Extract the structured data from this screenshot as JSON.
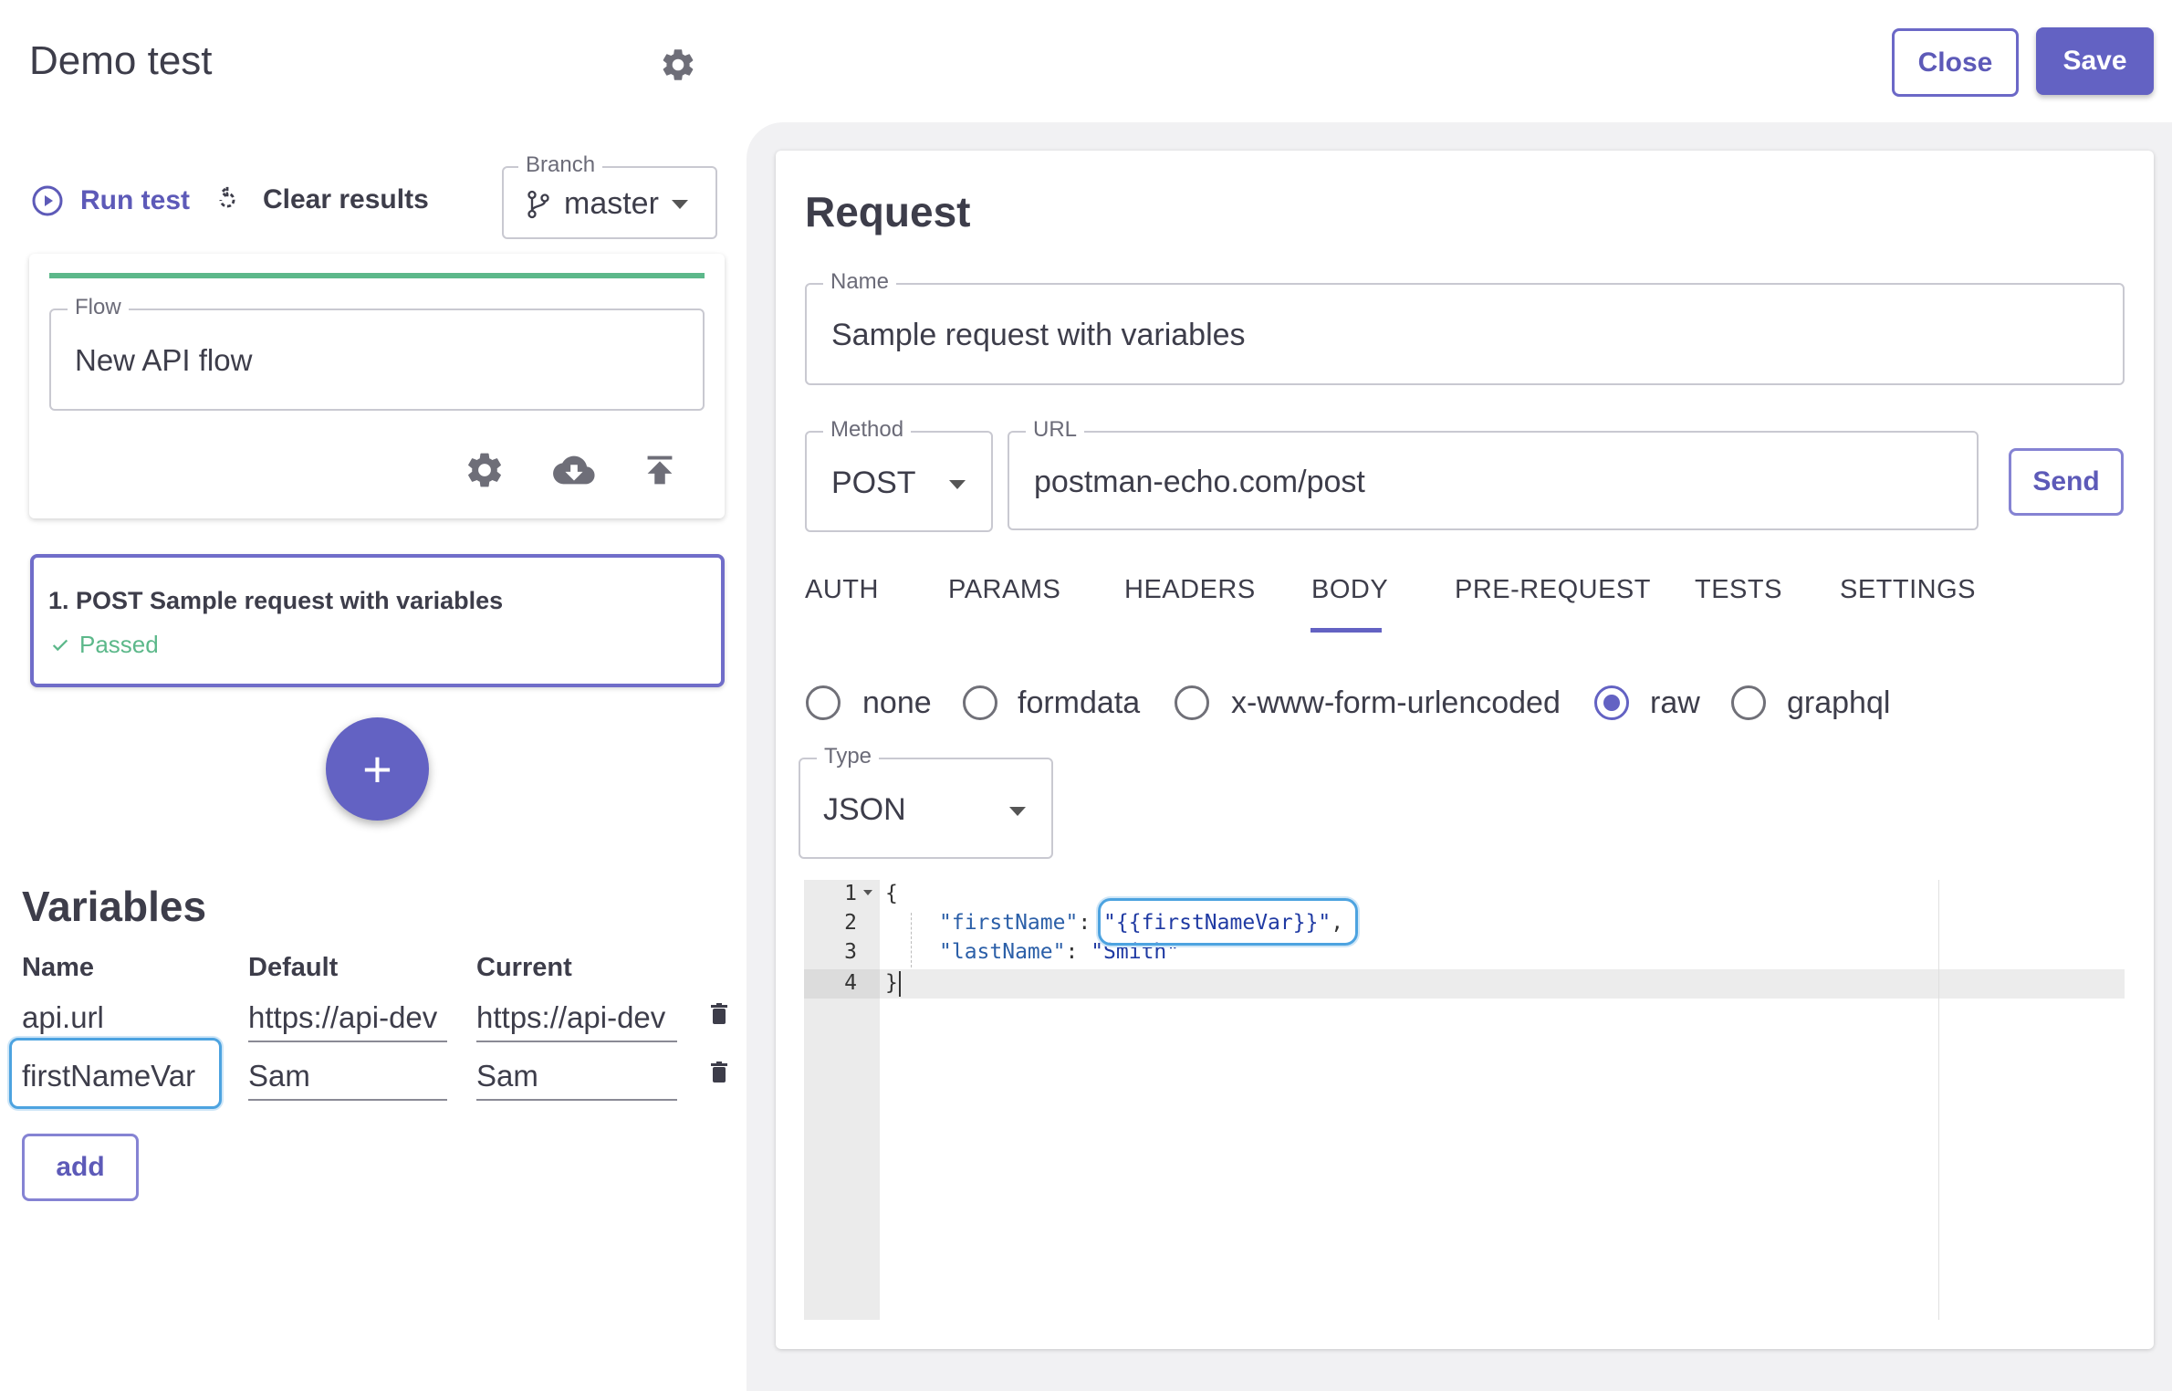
{
  "header": {
    "title": "Demo test",
    "close_label": "Close",
    "save_label": "Save"
  },
  "toolbar": {
    "run_test_label": "Run test",
    "clear_results_label": "Clear results",
    "branch_legend": "Branch",
    "branch_value": "master"
  },
  "flow": {
    "legend": "Flow",
    "value": "New API flow",
    "status_color": "#5cb88a"
  },
  "steps": [
    {
      "title": "1. POST Sample request with variables",
      "status": "Passed"
    }
  ],
  "add_step_label": "+",
  "variables": {
    "heading": "Variables",
    "columns": {
      "name": "Name",
      "default": "Default",
      "current": "Current"
    },
    "rows": [
      {
        "name": "api.url",
        "default": "https://api-dev",
        "current": "https://api-dev"
      },
      {
        "name": "firstNameVar",
        "default": "Sam",
        "current": "Sam"
      }
    ],
    "add_label": "add"
  },
  "request": {
    "heading": "Request",
    "name_legend": "Name",
    "name_value": "Sample request with variables",
    "method_legend": "Method",
    "method_value": "POST",
    "url_legend": "URL",
    "url_value": "postman-echo.com/post",
    "send_label": "Send",
    "tabs": [
      "AUTH",
      "PARAMS",
      "HEADERS",
      "BODY",
      "PRE-REQUEST",
      "TESTS",
      "SETTINGS"
    ],
    "active_tab": "BODY",
    "body_modes": [
      "none",
      "formdata",
      "x-www-form-urlencoded",
      "raw",
      "graphql"
    ],
    "selected_body_mode": "raw",
    "type_legend": "Type",
    "type_value": "JSON",
    "code": {
      "line_numbers": [
        "1",
        "2",
        "3",
        "4"
      ],
      "open_brace": "{",
      "close_brace": "}",
      "key1": "\"firstName\"",
      "val1": "\"{{firstNameVar}}\"",
      "key2": "\"lastName\"",
      "val2": "\"Smith\""
    }
  },
  "colors": {
    "accent": "#6362c3",
    "success": "#5cb88a",
    "focus": "#4da3e0"
  }
}
